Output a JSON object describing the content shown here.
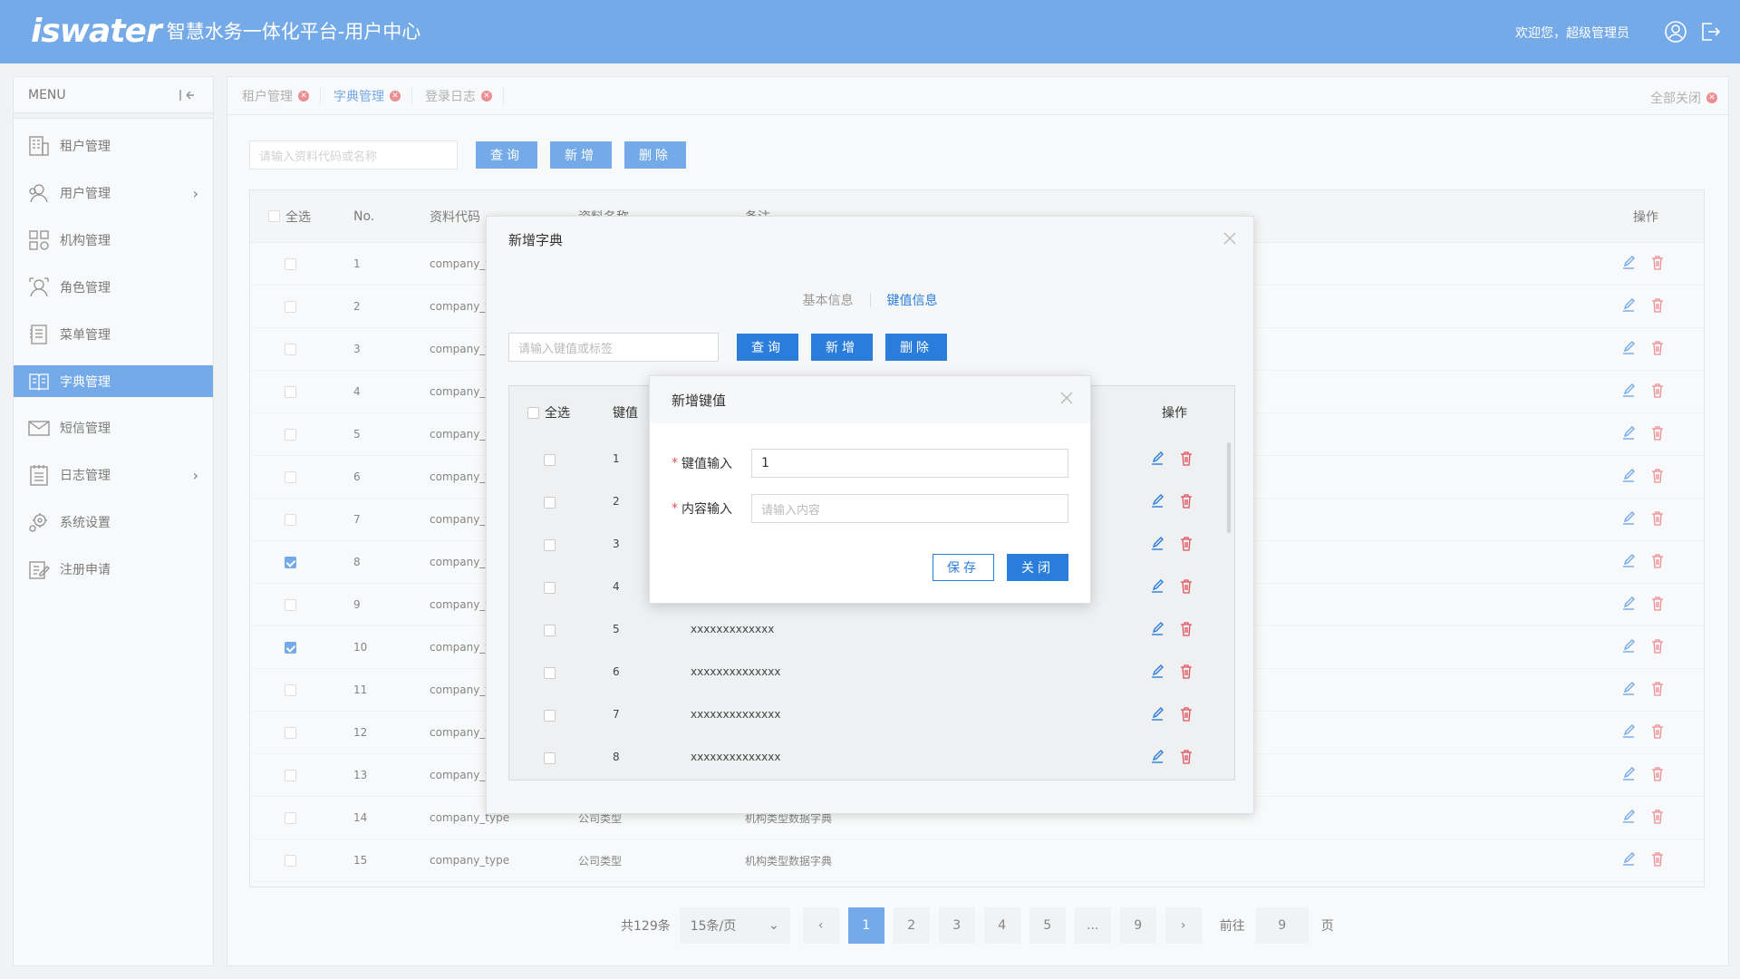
{
  "header": {
    "brand": "iswater",
    "title": "智慧水务一体化平台-用户中心",
    "welcome": "欢迎您，超级管理员"
  },
  "sidebar": {
    "menu_label": "MENU",
    "items": [
      {
        "label": "租户管理",
        "icon": "tenant-icon"
      },
      {
        "label": "用户管理",
        "icon": "users-icon",
        "arrow": "›"
      },
      {
        "label": "机构管理",
        "icon": "org-icon"
      },
      {
        "label": "角色管理",
        "icon": "role-icon"
      },
      {
        "label": "菜单管理",
        "icon": "menu-icon"
      },
      {
        "label": "字典管理",
        "icon": "dictionary-icon"
      },
      {
        "label": "短信管理",
        "icon": "sms-icon"
      },
      {
        "label": "日志管理",
        "icon": "log-icon",
        "arrow": "›"
      },
      {
        "label": "系统设置",
        "icon": "settings-icon"
      },
      {
        "label": "注册申请",
        "icon": "register-icon"
      }
    ]
  },
  "tabs": [
    {
      "label": "租户管理"
    },
    {
      "label": "字典管理"
    },
    {
      "label": "登录日志"
    }
  ],
  "close_all": "全部关闭",
  "toolbar": {
    "search_placeholder": "请输入资料代码或名称",
    "query": "查询",
    "add": "新增",
    "delete": "删除"
  },
  "table": {
    "headers": {
      "select_all": "全选",
      "no": "No.",
      "code": "资料代码",
      "name": "资料名称",
      "remark": "备注",
      "ops": "操作"
    },
    "rows": [
      {
        "no": "1",
        "code": "company_t",
        "checked": false
      },
      {
        "no": "2",
        "code": "company_t",
        "checked": false
      },
      {
        "no": "3",
        "code": "company_t",
        "checked": false
      },
      {
        "no": "4",
        "code": "company_t",
        "checked": false
      },
      {
        "no": "5",
        "code": "company_t",
        "checked": false
      },
      {
        "no": "6",
        "code": "company_t",
        "checked": false
      },
      {
        "no": "7",
        "code": "company_t",
        "checked": false
      },
      {
        "no": "8",
        "code": "company_t",
        "checked": true
      },
      {
        "no": "9",
        "code": "company_t",
        "checked": false
      },
      {
        "no": "10",
        "code": "company_t",
        "checked": true
      },
      {
        "no": "11",
        "code": "company_t",
        "checked": false
      },
      {
        "no": "12",
        "code": "company_t",
        "checked": false
      },
      {
        "no": "13",
        "code": "company_t",
        "checked": false
      },
      {
        "no": "14",
        "code": "company_type",
        "name": "公司类型",
        "remark": "机构类型数据字典",
        "checked": false
      },
      {
        "no": "15",
        "code": "company_type",
        "name": "公司类型",
        "remark": "机构类型数据字典",
        "checked": false
      }
    ]
  },
  "pagination": {
    "total": "共129条",
    "page_size": "15条/页",
    "pages": [
      "1",
      "2",
      "3",
      "4",
      "5",
      "...",
      "9"
    ],
    "prev": "‹",
    "next": "›",
    "goto_label": "前往",
    "goto_value": "9",
    "page_suffix": "页"
  },
  "dialog_dict": {
    "title": "新增字典",
    "subtabs": [
      "基本信息",
      "键值信息"
    ],
    "search_placeholder": "请输入键值或标签",
    "query": "查询",
    "add": "新增",
    "delete": "删除",
    "headers": {
      "select_all": "全选",
      "key": "键值",
      "ops": "操作"
    },
    "rows": [
      {
        "key": "1",
        "label": ""
      },
      {
        "key": "2",
        "label": ""
      },
      {
        "key": "3",
        "label": ""
      },
      {
        "key": "4",
        "label": ""
      },
      {
        "key": "5",
        "label": "xxxxxxxxxxxxx"
      },
      {
        "key": "6",
        "label": "xxxxxxxxxxxxxx"
      },
      {
        "key": "7",
        "label": "xxxxxxxxxxxxxx"
      },
      {
        "key": "8",
        "label": "xxxxxxxxxxxxxx"
      }
    ]
  },
  "dialog_key": {
    "title": "新增键值",
    "key_label": "键值输入",
    "key_value": "1",
    "content_label": "内容输入",
    "content_placeholder": "请输入内容",
    "save": "保存",
    "close": "关闭"
  },
  "colors": {
    "primary": "#2a7ddb",
    "danger": "#e0525a"
  }
}
